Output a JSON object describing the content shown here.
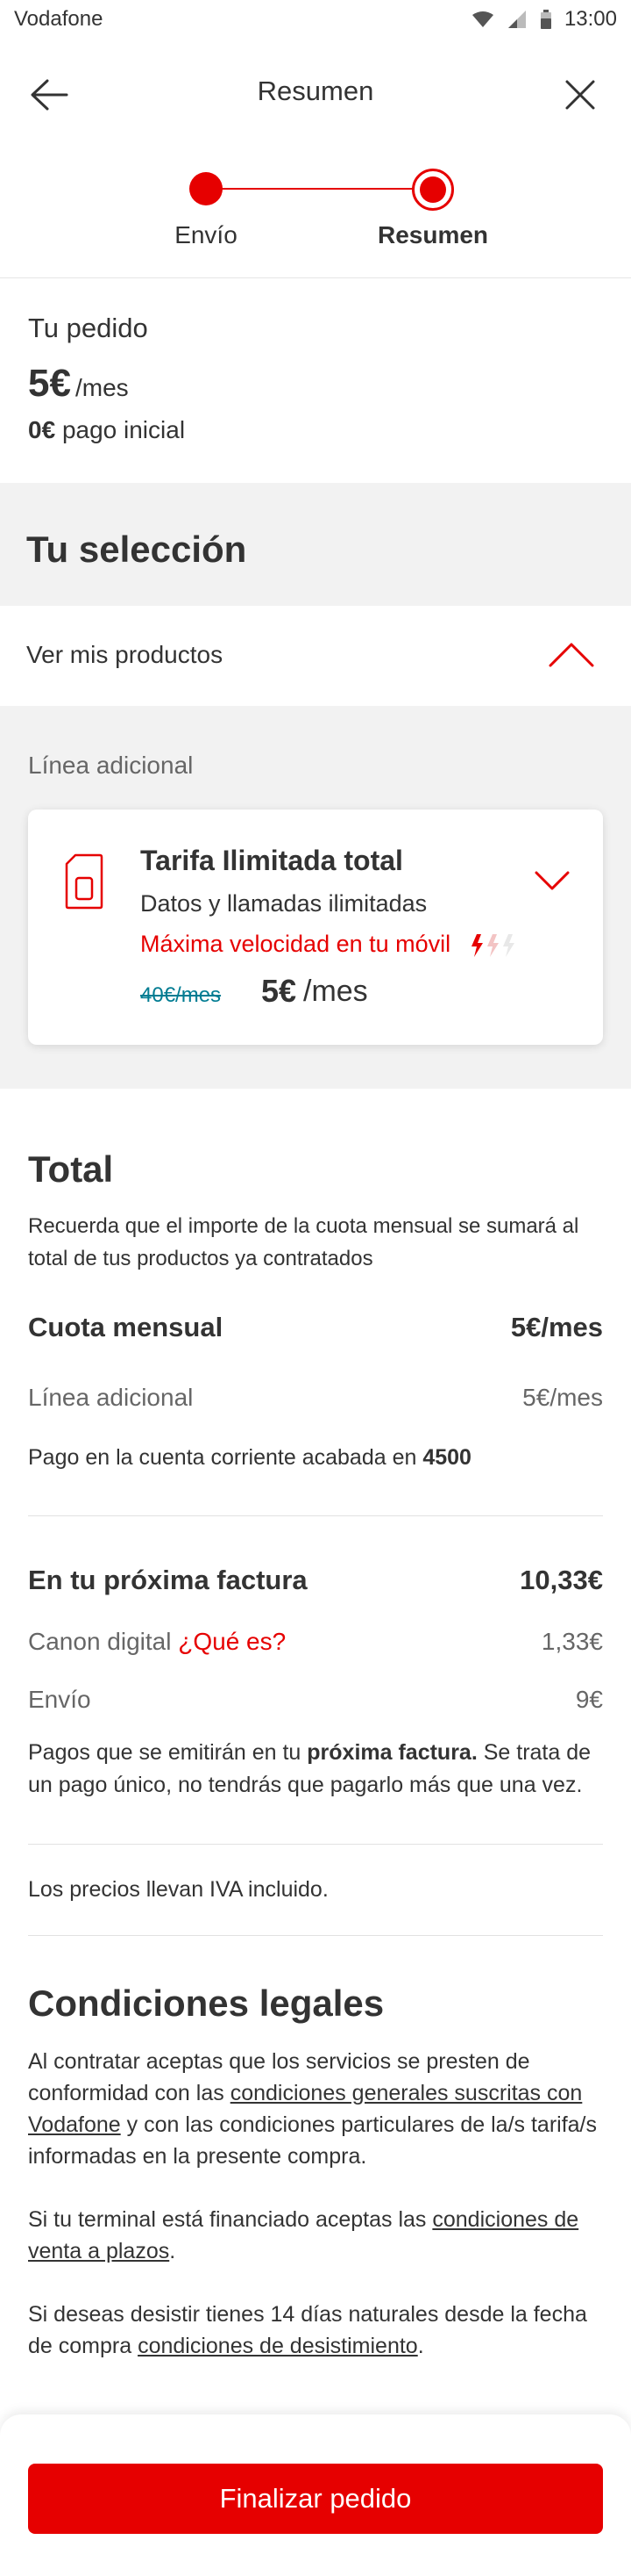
{
  "status_bar": {
    "carrier": "Vodafone",
    "time": "13:00"
  },
  "header": {
    "title": "Resumen"
  },
  "stepper": {
    "steps": [
      {
        "label": "Envío"
      },
      {
        "label": "Resumen"
      }
    ]
  },
  "order": {
    "title": "Tu pedido",
    "price": "5€",
    "price_unit": "/mes",
    "initial_amount": "0€",
    "initial_label": "pago inicial"
  },
  "selection": {
    "title": "Tu selección",
    "products_toggle": "Ver mis productos",
    "line_label": "Línea adicional",
    "card": {
      "title": "Tarifa Ilimitada total",
      "subtitle": "Datos y llamadas ilimitadas",
      "speed": "Máxima velocidad en tu móvil",
      "old_price": "40€/mes",
      "new_price": "5€",
      "new_price_unit": "/mes"
    }
  },
  "total": {
    "title": "Total",
    "description": "Recuerda que el importe de la cuota mensual se sumará al total de tus productos ya contratados",
    "monthly_label": "Cuota mensual",
    "monthly_value": "5€/mes",
    "line_label": "Línea adicional",
    "line_value": "5€/mes",
    "bank_prefix": "Pago en la cuenta corriente acabada en",
    "bank_digits": "4500",
    "next_invoice_label": "En tu próxima factura",
    "next_invoice_value": "10,33€",
    "canon_label": "Canon digital",
    "canon_link": "¿Qué es?",
    "canon_value": "1,33€",
    "shipping_label": "Envío",
    "shipping_value": "9€",
    "invoice_note_prefix": "Pagos que se emitirán en tu",
    "invoice_note_bold": "próxima factura.",
    "invoice_note_suffix": "Se trata de un pago único, no tendrás que pagarlo más que una vez.",
    "iva_note": "Los precios llevan IVA incluido."
  },
  "legal": {
    "title": "Condiciones legales",
    "p1_prefix": "Al contratar aceptas que los servicios se presten de conformidad con las",
    "p1_link": "condiciones generales suscritas con Vodafone",
    "p1_suffix": "y con las condiciones particulares de la/s tarifa/s informadas en la presente compra.",
    "p2_prefix": "Si tu terminal está financiado aceptas las",
    "p2_link": "condiciones de venta a plazos",
    "p2_suffix": ".",
    "p3_prefix": "Si deseas desistir tienes 14 días naturales desde la fecha de compra",
    "p3_link": "condiciones de desistimiento",
    "p3_suffix": "."
  },
  "footer": {
    "finish_button": "Finalizar pedido"
  },
  "colors": {
    "accent": "#e60000",
    "text": "#333333",
    "muted": "#666666",
    "teal": "#007c92",
    "section_bg": "#f2f2f2"
  },
  "icons": [
    "wifi-icon",
    "signal-icon",
    "battery-icon",
    "arrow-left-icon",
    "close-icon",
    "chevron-up-icon",
    "sim-card-icon",
    "chevron-down-icon",
    "lightning-icon"
  ]
}
